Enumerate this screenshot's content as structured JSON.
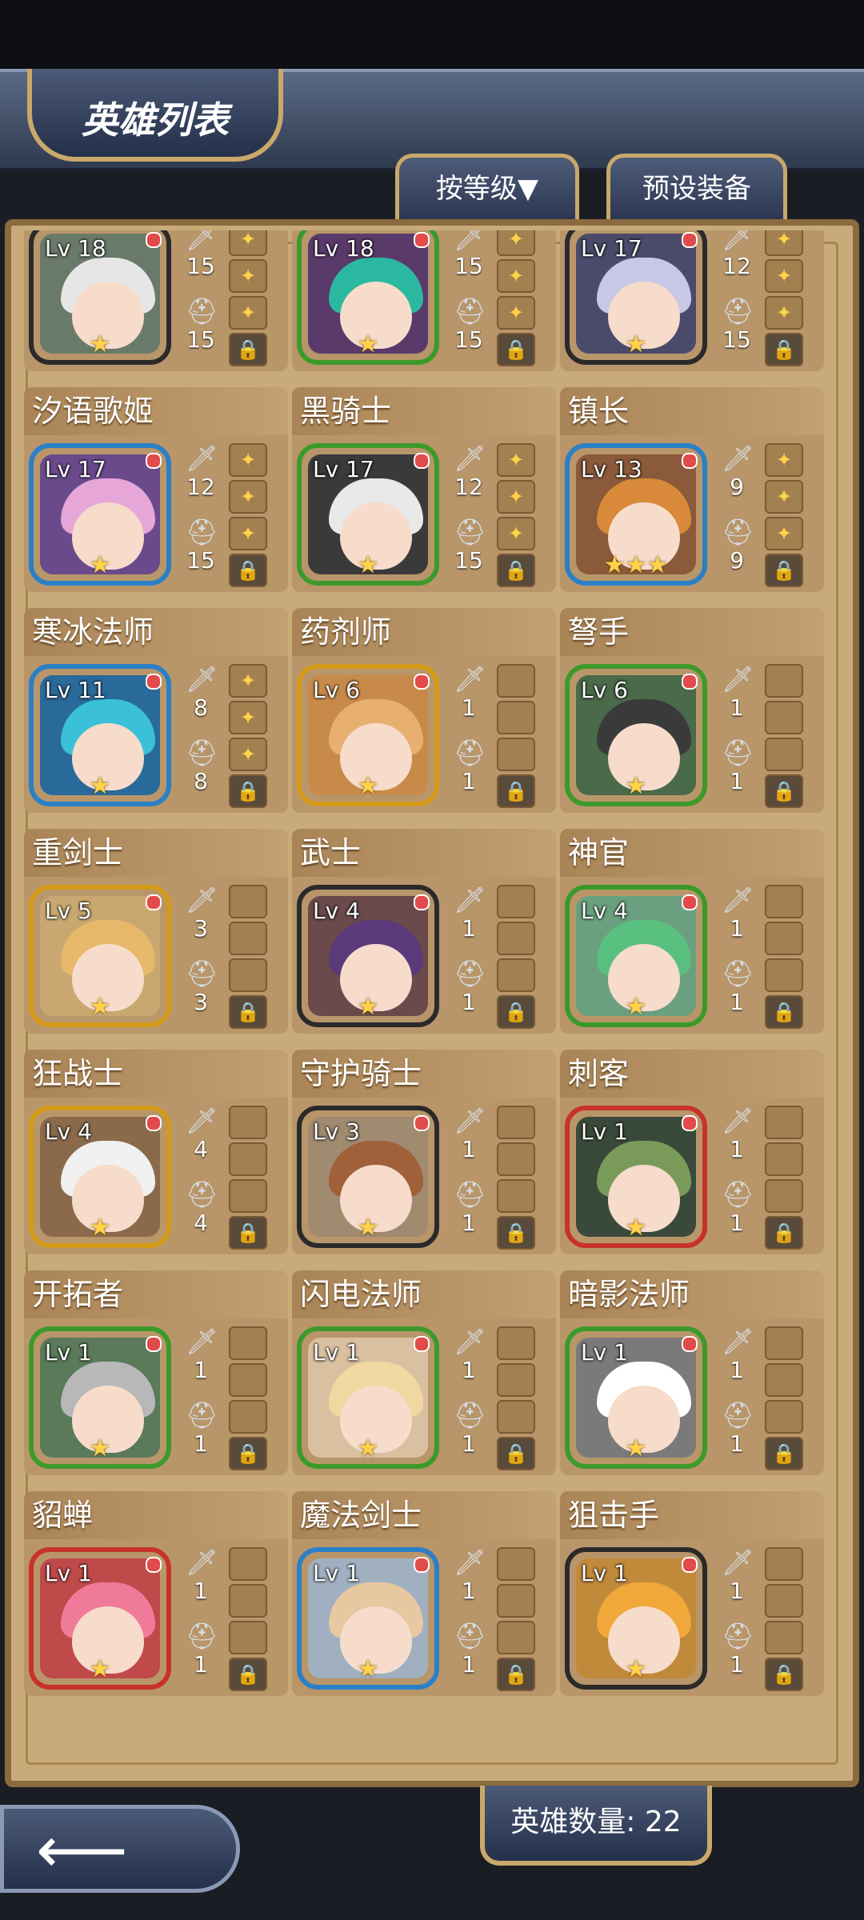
{
  "header": {
    "title": "英雄列表"
  },
  "buttons": {
    "sort": "按等级▼",
    "preset": "预设装备"
  },
  "footer": {
    "hero_count": "英雄数量: 22"
  },
  "heroes": [
    {
      "name": "",
      "level": "Lv 18",
      "stars": "★",
      "atk": "15",
      "def": "15",
      "frame": "#2a2a2a",
      "slots": [
        "✦",
        "✦",
        "✦",
        "🔒"
      ]
    },
    {
      "name": "",
      "level": "Lv 18",
      "stars": "★",
      "atk": "15",
      "def": "15",
      "frame": "#3d9a2a",
      "slots": [
        "✦",
        "✦",
        "✦",
        "🔒"
      ]
    },
    {
      "name": "",
      "level": "Lv 17",
      "stars": "★",
      "atk": "12",
      "def": "15",
      "frame": "#2a2a2a",
      "slots": [
        "✦",
        "✦",
        "✦",
        "🔒"
      ]
    },
    {
      "name": "汐语歌姬",
      "level": "Lv 17",
      "stars": "★",
      "atk": "12",
      "def": "15",
      "frame": "#2b7fc6",
      "slots": [
        "✦",
        "✦",
        "✦",
        "🔒"
      ]
    },
    {
      "name": "黑骑士",
      "level": "Lv 17",
      "stars": "★",
      "atk": "12",
      "def": "15",
      "frame": "#3d9a2a",
      "slots": [
        "✦",
        "✦",
        "✦",
        "🔒"
      ]
    },
    {
      "name": "镇长",
      "level": "Lv 13",
      "stars": "★★★",
      "atk": "9",
      "def": "9",
      "frame": "#2b7fc6",
      "slots": [
        "✦",
        "✦",
        "✦",
        "🔒"
      ]
    },
    {
      "name": "寒冰法师",
      "level": "Lv 11",
      "stars": "★",
      "atk": "8",
      "def": "8",
      "frame": "#2b7fc6",
      "slots": [
        "✦",
        "✦",
        "✦",
        "🔒"
      ]
    },
    {
      "name": "药剂师",
      "level": "Lv 6",
      "stars": "★",
      "atk": "1",
      "def": "1",
      "frame": "#d49a18",
      "slots": [
        "",
        "",
        "",
        "🔒"
      ]
    },
    {
      "name": "弩手",
      "level": "Lv 6",
      "stars": "★",
      "atk": "1",
      "def": "1",
      "frame": "#3d9a2a",
      "slots": [
        "",
        "",
        "",
        "🔒"
      ]
    },
    {
      "name": "重剑士",
      "level": "Lv 5",
      "stars": "★",
      "atk": "3",
      "def": "3",
      "frame": "#d49a18",
      "slots": [
        "",
        "",
        "",
        "🔒"
      ]
    },
    {
      "name": "武士",
      "level": "Lv 4",
      "stars": "★",
      "atk": "1",
      "def": "1",
      "frame": "#2a2a2a",
      "slots": [
        "",
        "",
        "",
        "🔒"
      ]
    },
    {
      "name": "神官",
      "level": "Lv 4",
      "stars": "★",
      "atk": "1",
      "def": "1",
      "frame": "#3d9a2a",
      "slots": [
        "",
        "",
        "",
        "🔒"
      ]
    },
    {
      "name": "狂战士",
      "level": "Lv 4",
      "stars": "★",
      "atk": "4",
      "def": "4",
      "frame": "#d49a18",
      "slots": [
        "",
        "",
        "",
        "🔒"
      ]
    },
    {
      "name": "守护骑士",
      "level": "Lv 3",
      "stars": "★",
      "atk": "1",
      "def": "1",
      "frame": "#2a2a2a",
      "slots": [
        "",
        "",
        "",
        "🔒"
      ]
    },
    {
      "name": "刺客",
      "level": "Lv 1",
      "stars": "★",
      "atk": "1",
      "def": "1",
      "frame": "#c8322a",
      "slots": [
        "",
        "",
        "",
        "🔒"
      ]
    },
    {
      "name": "开拓者",
      "level": "Lv 1",
      "stars": "★",
      "atk": "1",
      "def": "1",
      "frame": "#3d9a2a",
      "slots": [
        "",
        "",
        "",
        "🔒"
      ]
    },
    {
      "name": "闪电法师",
      "level": "Lv 1",
      "stars": "★",
      "atk": "1",
      "def": "1",
      "frame": "#3d9a2a",
      "slots": [
        "",
        "",
        "",
        "🔒"
      ]
    },
    {
      "name": "暗影法师",
      "level": "Lv 1",
      "stars": "★",
      "atk": "1",
      "def": "1",
      "frame": "#3d9a2a",
      "slots": [
        "",
        "",
        "",
        "🔒"
      ]
    },
    {
      "name": "貂蝉",
      "level": "Lv 1",
      "stars": "★",
      "atk": "1",
      "def": "1",
      "frame": "#c8322a",
      "slots": [
        "",
        "",
        "",
        "🔒"
      ]
    },
    {
      "name": "魔法剑士",
      "level": "Lv 1",
      "stars": "★",
      "atk": "1",
      "def": "1",
      "frame": "#2b7fc6",
      "slots": [
        "",
        "",
        "",
        "🔒"
      ]
    },
    {
      "name": "狙击手",
      "level": "Lv 1",
      "stars": "★",
      "atk": "1",
      "def": "1",
      "frame": "#2a2a2a",
      "slots": [
        "",
        "",
        "",
        "🔒"
      ]
    }
  ],
  "icons": {
    "sword": "sword-icon",
    "helmet": "helmet-icon",
    "lock": "lock-icon",
    "back": "back-arrow-icon"
  },
  "colors": {
    "panel": "#c9ab7a",
    "card_header": "#a98457",
    "star": "#ffd24a"
  }
}
